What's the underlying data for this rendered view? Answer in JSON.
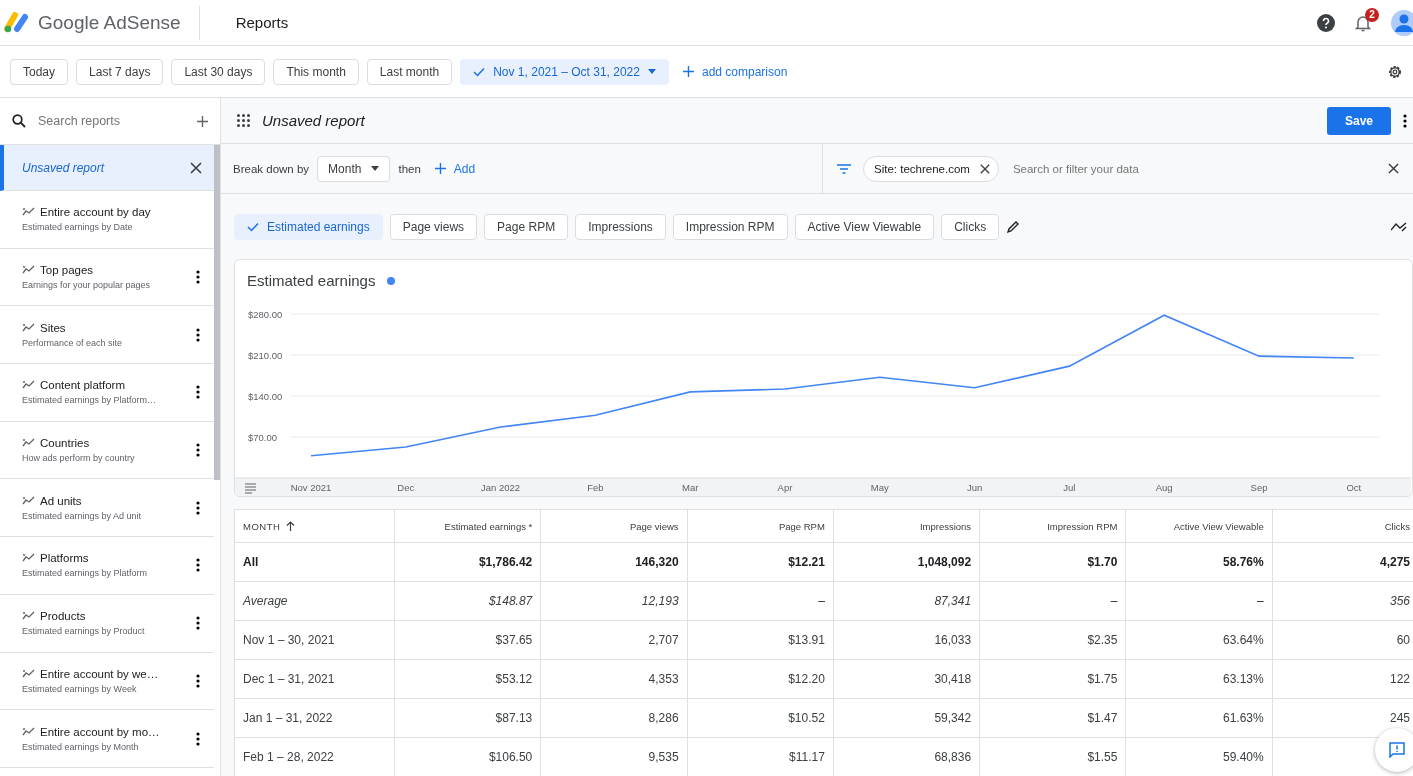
{
  "header": {
    "product": "Google AdSense",
    "page": "Reports",
    "notification_count": "2"
  },
  "date_chips": [
    {
      "kind": "preset",
      "label": "Today",
      "selected": false
    },
    {
      "kind": "preset",
      "label": "Last 7 days",
      "selected": false
    },
    {
      "kind": "preset",
      "label": "Last 30 days",
      "selected": false
    },
    {
      "kind": "preset",
      "label": "This month",
      "selected": false
    },
    {
      "kind": "preset",
      "label": "Last month",
      "selected": false
    },
    {
      "kind": "range",
      "label": "Nov 1, 2021 – Oct 31, 2022",
      "selected": true
    }
  ],
  "add_comparison": "add comparison",
  "sidebar": {
    "search_placeholder": "Search reports",
    "items": [
      {
        "kind": "draft",
        "title": "Unsaved report",
        "selected": true
      },
      {
        "kind": "report",
        "title": "Entire account by day",
        "subtitle": "Estimated earnings by Date",
        "selected": false,
        "menu": false
      },
      {
        "kind": "report",
        "title": "Top pages",
        "subtitle": "Earnings for your popular pages",
        "selected": false,
        "menu": true
      },
      {
        "kind": "report",
        "title": "Sites",
        "subtitle": "Performance of each site",
        "selected": false,
        "menu": true
      },
      {
        "kind": "report",
        "title": "Content platform",
        "subtitle": "Estimated earnings by Platform…",
        "selected": false,
        "menu": true
      },
      {
        "kind": "report",
        "title": "Countries",
        "subtitle": "How ads perform by country",
        "selected": false,
        "menu": true
      },
      {
        "kind": "report",
        "title": "Ad units",
        "subtitle": "Estimated earnings by Ad unit",
        "selected": false,
        "menu": true
      },
      {
        "kind": "report",
        "title": "Platforms",
        "subtitle": "Estimated earnings by Platform",
        "selected": false,
        "menu": true
      },
      {
        "kind": "report",
        "title": "Products",
        "subtitle": "Estimated earnings by Product",
        "selected": false,
        "menu": true
      },
      {
        "kind": "report",
        "title": "Entire account by we…",
        "subtitle": "Estimated earnings by Week",
        "selected": false,
        "menu": true
      },
      {
        "kind": "report",
        "title": "Entire account by mo…",
        "subtitle": "Estimated earnings by Month",
        "selected": false,
        "menu": true
      }
    ]
  },
  "report": {
    "title": "Unsaved report",
    "save": "Save"
  },
  "breakdown": {
    "label": "Break down by",
    "value": "Month",
    "then": "then",
    "add": "Add"
  },
  "filter": {
    "chip": "Site: techrene.com",
    "placeholder": "Search or filter your data"
  },
  "metrics": [
    {
      "label": "Estimated earnings",
      "selected": true
    },
    {
      "label": "Page views",
      "selected": false
    },
    {
      "label": "Page RPM",
      "selected": false
    },
    {
      "label": "Impressions",
      "selected": false
    },
    {
      "label": "Impression RPM",
      "selected": false
    },
    {
      "label": "Active View Viewable",
      "selected": false
    },
    {
      "label": "Clicks",
      "selected": false
    }
  ],
  "chart": {
    "chart_data": {
      "type": "line",
      "grid": true,
      "categories": [
        "Nov 2021",
        "Dec",
        "Jan 2022",
        "Feb",
        "Mar",
        "Apr",
        "May",
        "Jun",
        "Jul",
        "Aug",
        "Sep",
        "Oct"
      ],
      "series": [
        {
          "name": "Estimated earnings",
          "color": "#4285f4",
          "values": [
            38,
            53,
            87,
            107,
            147,
            152,
            172,
            154,
            191,
            278,
            208,
            205
          ]
        }
      ],
      "ylim": [
        0,
        280
      ],
      "yticks": [
        {
          "value": 70,
          "label": "$70.00"
        },
        {
          "value": 140,
          "label": "$140.00"
        },
        {
          "value": 210,
          "label": "$210.00"
        },
        {
          "value": 280,
          "label": "$280.00"
        }
      ]
    }
  },
  "table": {
    "columns": [
      {
        "label": "MONTH",
        "sorted": true
      },
      {
        "label": "Estimated earnings *",
        "sorted": false
      },
      {
        "label": "Page views",
        "sorted": false
      },
      {
        "label": "Page RPM",
        "sorted": false
      },
      {
        "label": "Impressions",
        "sorted": false
      },
      {
        "label": "Impression RPM",
        "sorted": false
      },
      {
        "label": "Active View Viewable",
        "sorted": false
      },
      {
        "label": "Clicks",
        "sorted": false
      }
    ],
    "rows": [
      {
        "kind": "total",
        "cells": [
          "All",
          "$1,786.42",
          "146,320",
          "$12.21",
          "1,048,092",
          "$1.70",
          "58.76%",
          "4,275"
        ]
      },
      {
        "kind": "average",
        "cells": [
          "Average",
          "$148.87",
          "12,193",
          "–",
          "87,341",
          "–",
          "–",
          "356"
        ]
      },
      {
        "kind": "data",
        "cells": [
          "Nov 1 – 30, 2021",
          "$37.65",
          "2,707",
          "$13.91",
          "16,033",
          "$2.35",
          "63.64%",
          "60"
        ]
      },
      {
        "kind": "data",
        "cells": [
          "Dec 1 – 31, 2021",
          "$53.12",
          "4,353",
          "$12.20",
          "30,418",
          "$1.75",
          "63.13%",
          "122"
        ]
      },
      {
        "kind": "data",
        "cells": [
          "Jan 1 – 31, 2022",
          "$87.13",
          "8,286",
          "$10.52",
          "59,342",
          "$1.47",
          "61.63%",
          "245"
        ]
      },
      {
        "kind": "data",
        "cells": [
          "Feb 1 – 28, 2022",
          "$106.50",
          "9,535",
          "$11.17",
          "68,836",
          "$1.55",
          "59.40%",
          ""
        ]
      }
    ]
  }
}
